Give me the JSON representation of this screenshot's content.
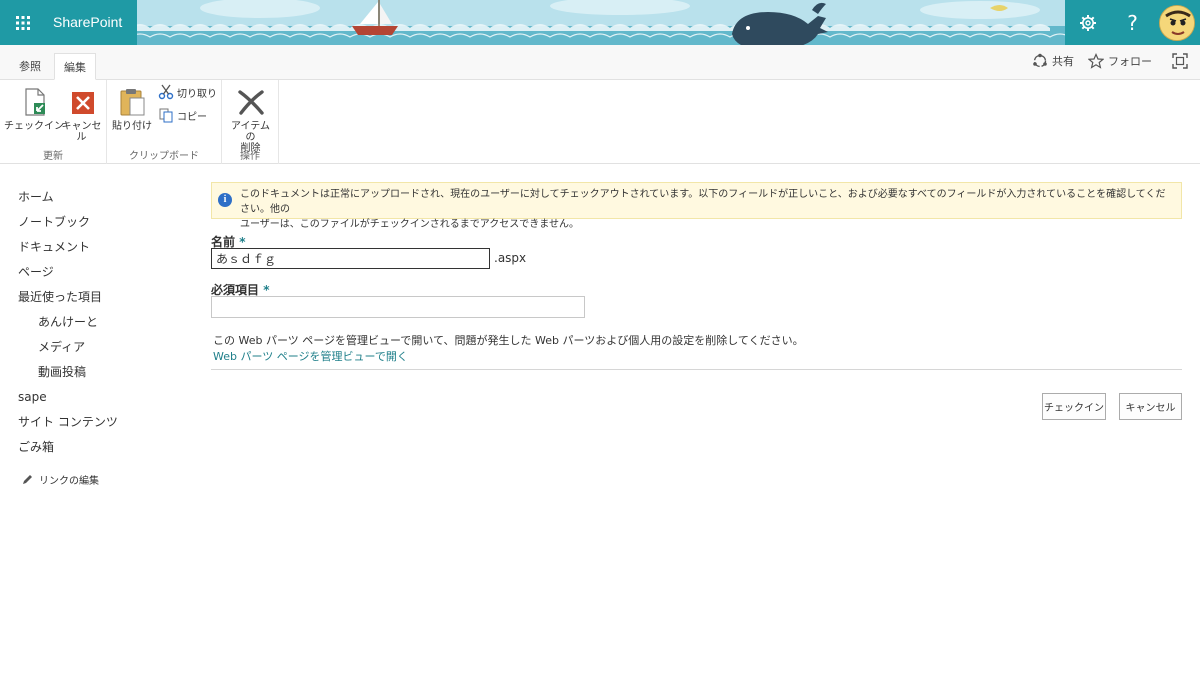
{
  "suite_bar": {
    "brand": "SharePoint",
    "icons": [
      "app-launcher-icon",
      "gear-icon",
      "help-icon",
      "avatar"
    ],
    "help_glyph": "?",
    "colors": {
      "bar": "#1f9aa5",
      "sky": "#a9d8e6",
      "sea": "#3da4b8"
    }
  },
  "ribbon_tabs": {
    "browse": "参照",
    "edit": "編集",
    "active": "編集"
  },
  "page_actions": {
    "share": "共有",
    "follow": "フォロー"
  },
  "ribbon": {
    "groups": {
      "update": "更新",
      "clipboard": "クリップボード",
      "actions": "操作"
    },
    "buttons": {
      "checkin": "チェックイン",
      "cancel": "キャンセル",
      "paste": "貼り付け",
      "cut": "切り取り",
      "copy": "コピー",
      "delete_item_1": "アイテムの",
      "delete_item_2": "削除"
    }
  },
  "leftnav": {
    "items": [
      {
        "label": "ホーム"
      },
      {
        "label": "ノートブック"
      },
      {
        "label": "ドキュメント"
      },
      {
        "label": "ページ"
      },
      {
        "label": "最近使った項目"
      },
      {
        "label": "あんけーと"
      },
      {
        "label": "メディア"
      },
      {
        "label": "動画投稿"
      },
      {
        "label": "sape"
      },
      {
        "label": "サイト コンテンツ"
      },
      {
        "label": "ごみ箱"
      }
    ],
    "edit_links": "リンクの編集"
  },
  "form": {
    "notice_line1": "このドキュメントは正常にアップロードされ、現在のユーザーに対してチェックアウトされています。以下のフィールドが正しいこと、および必要なすべてのフィールドが入力されていることを確認してください。他の",
    "notice_line2": "ユーザーは、このファイルがチェックインされるまでアクセスできません。",
    "name_label": "名前",
    "required_mark": "*",
    "name_value": "あｓｄｆｇ",
    "extension": ".aspx",
    "required_label": "必須項目",
    "required_value": "",
    "webpart_message": "この Web パーツ ページを管理ビューで開いて、問題が発生した Web パーツおよび個人用の設定を削除してください。",
    "webpart_link": "Web パーツ ページを管理ビューで開く",
    "checkin_button": "チェックイン",
    "cancel_button": "キャンセル"
  }
}
